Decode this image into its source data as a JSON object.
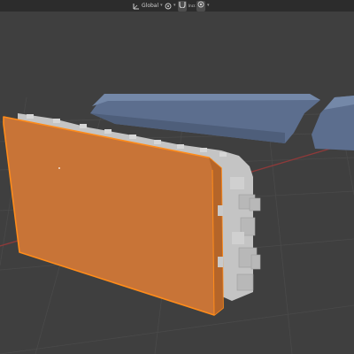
{
  "header": {
    "transform_orientation": "Global",
    "snap_label": "Incr."
  },
  "icons": {
    "orientation": "global-orientation-icon",
    "pivot": "pivot-point-icon",
    "snap": "snap-magnet-icon",
    "proportional": "proportional-editing-icon"
  },
  "colors": {
    "background": "#3f3f3f",
    "grid": "#4a4a4a",
    "x_axis": "#8e3a3a",
    "selected_object": "#c87437",
    "selection_outline": "#ff8c1a",
    "other_object": "#5c6e8e",
    "model_gray": "#c4c4c4"
  }
}
